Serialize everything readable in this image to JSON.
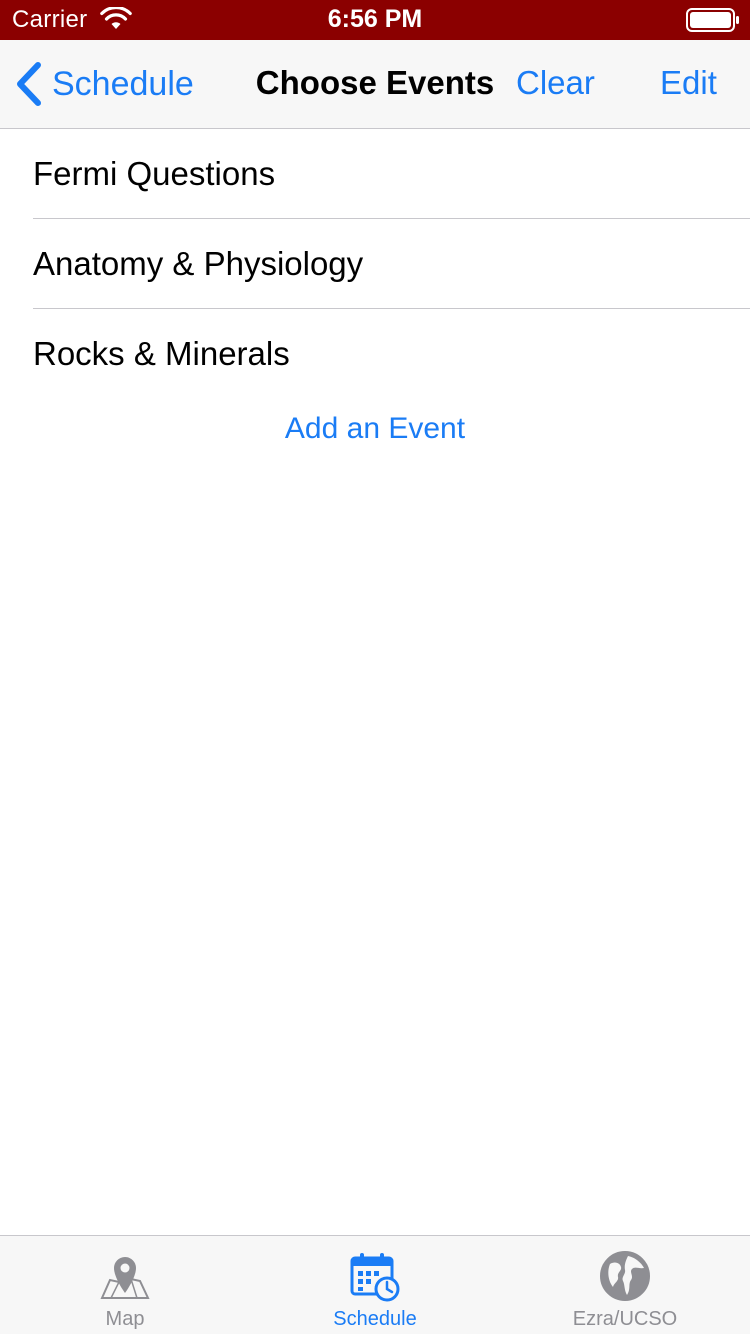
{
  "status_bar": {
    "carrier": "Carrier",
    "time": "6:56 PM"
  },
  "nav": {
    "back_label": "Schedule",
    "title": "Choose Events",
    "clear_label": "Clear",
    "edit_label": "Edit"
  },
  "events": [
    {
      "name": "Fermi Questions"
    },
    {
      "name": "Anatomy & Physiology"
    },
    {
      "name": "Rocks & Minerals"
    }
  ],
  "add_event_label": "Add an Event",
  "tabs": [
    {
      "label": "Map",
      "icon": "map-icon",
      "active": false
    },
    {
      "label": "Schedule",
      "icon": "calendar-icon",
      "active": true
    },
    {
      "label": "Ezra/UCSO",
      "icon": "globe-icon",
      "active": false
    }
  ],
  "colors": {
    "status_bar_bg": "#8b0000",
    "accent": "#1a7cf5",
    "inactive_tab": "#8e8e93"
  }
}
